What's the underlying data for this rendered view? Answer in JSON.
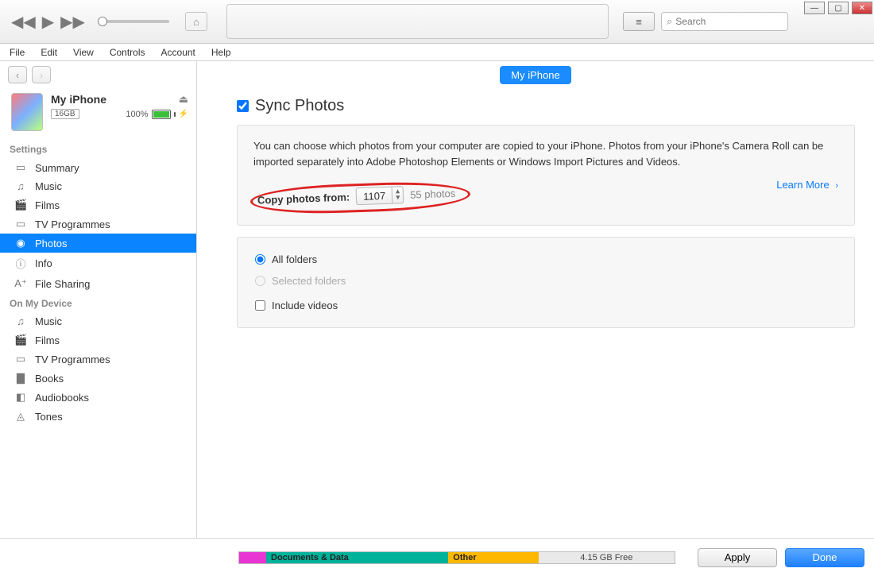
{
  "window_buttons": {
    "minimize": "—",
    "maximize": "▢",
    "close": "✕"
  },
  "toolbar": {
    "prev": "◀◀",
    "play": "▶",
    "next": "▶▶",
    "airplay": "⌂",
    "apple": "",
    "list": "≡",
    "search_placeholder": "Search",
    "search_icon": "⌕"
  },
  "menubar": [
    "File",
    "Edit",
    "View",
    "Controls",
    "Account",
    "Help"
  ],
  "nav": {
    "back": "‹",
    "fwd": "›"
  },
  "device": {
    "name": "My iPhone",
    "eject": "⏏",
    "capacity": "16GB",
    "battery_pct": "100%",
    "bolt": "⚡"
  },
  "sidebar": {
    "settings_hdr": "Settings",
    "settings": [
      {
        "icon": "▭",
        "label": "Summary"
      },
      {
        "icon": "♫",
        "label": "Music"
      },
      {
        "icon": "🎬",
        "label": "Films"
      },
      {
        "icon": "▭",
        "label": "TV Programmes"
      },
      {
        "icon": "◉",
        "label": "Photos",
        "selected": true
      },
      {
        "icon": "ⓘ",
        "label": "Info"
      },
      {
        "icon": "A⁺",
        "label": "File Sharing"
      }
    ],
    "device_hdr": "On My Device",
    "device_items": [
      {
        "icon": "♫",
        "label": "Music"
      },
      {
        "icon": "🎬",
        "label": "Films"
      },
      {
        "icon": "▭",
        "label": "TV Programmes"
      },
      {
        "icon": "▇",
        "label": "Books"
      },
      {
        "icon": "◧",
        "label": "Audiobooks"
      },
      {
        "icon": "◬",
        "label": "Tones"
      }
    ]
  },
  "crumb": "My iPhone",
  "sync": {
    "title": "Sync Photos",
    "desc": "You can choose which photos from your computer are copied to your iPhone. Photos from your iPhone's Camera Roll can be imported separately into Adobe Photoshop Elements or Windows Import Pictures and Videos.",
    "copy_label": "Copy photos from:",
    "folder": "1107",
    "count": "55 photos",
    "learn_more": "Learn More",
    "chev": "›"
  },
  "opts": {
    "all": "All folders",
    "sel": "Selected folders",
    "inc": "Include videos"
  },
  "storage": {
    "docs": "Documents & Data",
    "other": "Other",
    "free": "4.15 GB Free"
  },
  "footer": {
    "apply": "Apply",
    "done": "Done"
  }
}
